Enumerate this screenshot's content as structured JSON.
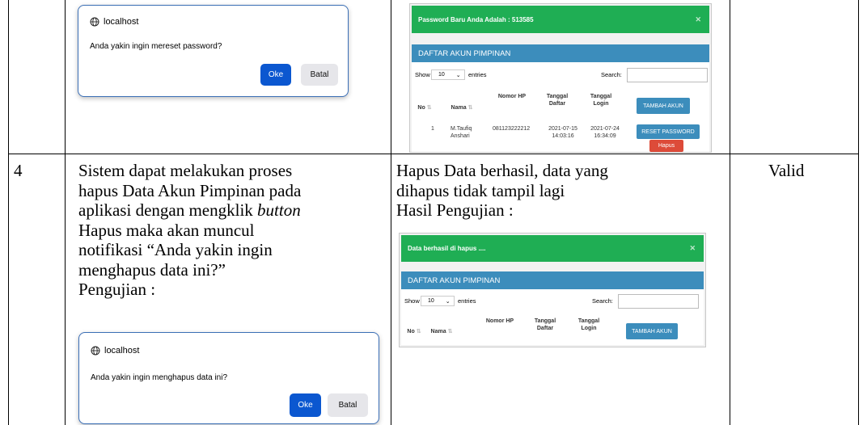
{
  "row_top": {
    "dialog": {
      "host": "localhost",
      "message": "Anda yakin ingin mereset password?",
      "ok": "Oke",
      "cancel": "Batal"
    },
    "screenshot": {
      "alert": "Password Baru Anda Adalah : 513585",
      "box_title": "DAFTAR AKUN PIMPINAN",
      "show": "Show",
      "entries_value": "10",
      "entries": "entries",
      "search": "Search:",
      "headers": [
        "No",
        "Nama",
        "Nomor HP",
        "Tanggal Daftar",
        "Tanggal Login"
      ],
      "add_button": "TAMBAH AKUN",
      "row": {
        "no": "1",
        "nama": "M.Taufiq Anshari",
        "hp": "081123222212",
        "daftar": "2021-07-15 14:03:16",
        "login": "2021-07-24 16:34:09"
      },
      "reset_button": "RESET PASSWORD",
      "delete_button": "Hapus"
    }
  },
  "row4": {
    "number": "4",
    "description_line1": "Sistem dapat melakukan proses",
    "description_line2": "hapus Data Akun Pimpinan pada",
    "description_line3a": "aplikasi dengan mengklik ",
    "description_line3b": "button",
    "description_line4": "Hapus maka akan muncul",
    "description_line5": "notifikasi “Anda yakin ingin",
    "description_line6": "menghapus data ini?”",
    "pengujian": "Pengujian :",
    "dialog": {
      "host": "localhost",
      "message": "Anda yakin ingin menghapus data ini?",
      "ok": "Oke",
      "cancel": "Batal"
    },
    "result_line1": "Hapus Data berhasil, data yang",
    "result_line2": "dihapus tidak tampil lagi",
    "hasil": "Hasil Pengujian :",
    "screenshot": {
      "alert": "Data berhasil di hapus ....",
      "box_title": "DAFTAR AKUN PIMPINAN",
      "show": "Show",
      "entries_value": "10",
      "entries": "entries",
      "search": "Search:",
      "headers": [
        "No",
        "Nama",
        "Nomor HP",
        "Tanggal Daftar",
        "Tanggal Login"
      ],
      "add_button": "TAMBAH AKUN"
    },
    "status": "Valid"
  }
}
